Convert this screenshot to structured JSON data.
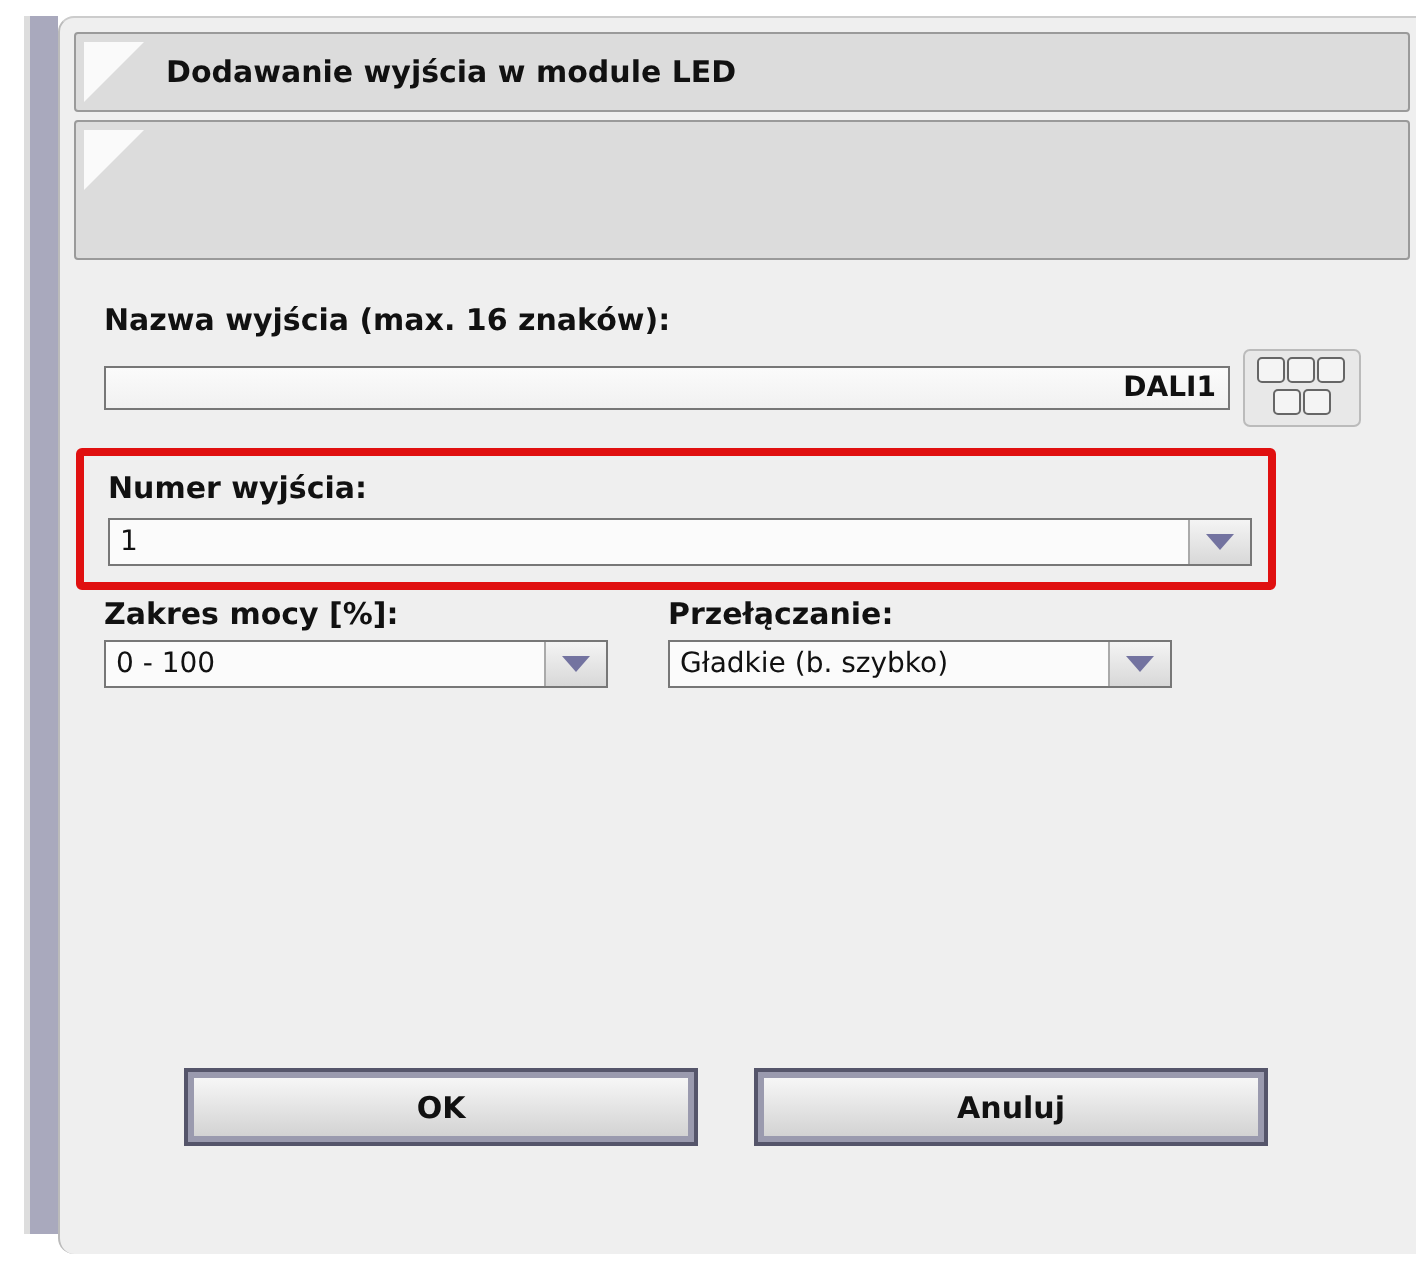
{
  "dialog": {
    "title": "Dodawanie wyjścia w module LED"
  },
  "name_field": {
    "label": "Nazwa wyjścia (max. 16 znaków):",
    "value": "DALI1"
  },
  "output_number": {
    "label": "Numer wyjścia:",
    "value": "1",
    "highlighted": true
  },
  "power_range": {
    "label": "Zakres mocy [%]:",
    "value": "0 - 100"
  },
  "switching": {
    "label": "Przełączanie:",
    "value": "Gładkie (b. szybko)"
  },
  "buttons": [
    {
      "label": "OK"
    },
    {
      "label": "Anuluj"
    }
  ]
}
